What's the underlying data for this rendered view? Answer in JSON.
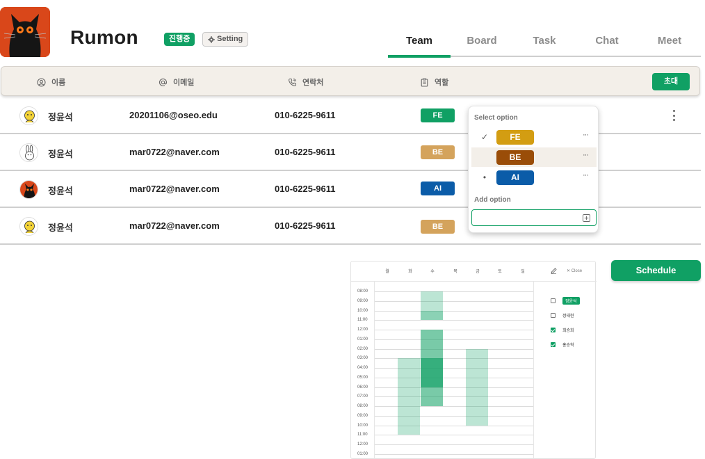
{
  "project": {
    "title": "Rumon",
    "status_badge": "진행중",
    "setting_label": "Setting"
  },
  "tabs": [
    {
      "label": "Team",
      "active": true
    },
    {
      "label": "Board",
      "active": false
    },
    {
      "label": "Task",
      "active": false
    },
    {
      "label": "Chat",
      "active": false
    },
    {
      "label": "Meet",
      "active": false
    }
  ],
  "table": {
    "columns": [
      {
        "label": "이름",
        "icon": "user-circle-icon"
      },
      {
        "label": "이메일",
        "icon": "at-icon"
      },
      {
        "label": "연락처",
        "icon": "phone-icon"
      },
      {
        "label": "역할",
        "icon": "clipboard-icon"
      }
    ],
    "invite_label": "초대",
    "rows": [
      {
        "name": "정윤석",
        "email": "20201106@oseo.edu",
        "phone": "010-6225-9611",
        "role": "FE",
        "avatar": "yellow-cartoon"
      },
      {
        "name": "정윤석",
        "email": "mar0722@naver.com",
        "phone": "010-6225-9611",
        "role": "BE",
        "avatar": "rabbit-sketch"
      },
      {
        "name": "정윤석",
        "email": "mar0722@naver.com",
        "phone": "010-6225-9611",
        "role": "AI",
        "avatar": "black-cat"
      },
      {
        "name": "정윤석",
        "email": "mar0722@naver.com",
        "phone": "010-6225-9611",
        "role": "BE",
        "avatar": "yellow-cartoon"
      }
    ]
  },
  "role_colors": {
    "FE": "#10a064",
    "BE": "#d4a35c",
    "AI": "#0b5ca8"
  },
  "dropdown": {
    "title": "Select option",
    "options": [
      {
        "label": "FE",
        "marker": "✓",
        "color": "#d39d12"
      },
      {
        "label": "BE",
        "marker": "",
        "color": "#9a4d08"
      },
      {
        "label": "AI",
        "marker": "•",
        "color": "#0b5ca8"
      }
    ],
    "more_label": "···",
    "add_label": "Add option",
    "input_value": ""
  },
  "schedule": {
    "button_label": "Schedule",
    "close_label": "Close",
    "days": [
      "월",
      "화",
      "수",
      "목",
      "금",
      "토",
      "일"
    ],
    "times": [
      "08:00",
      "09:00",
      "10:00",
      "11:00",
      "12:00",
      "01:00",
      "02:00",
      "03:00",
      "04:00",
      "05:00",
      "06:00",
      "07:00",
      "08:00",
      "09:00",
      "10:00",
      "11:00",
      "12:00",
      "01:00"
    ],
    "availability_slots": [
      {
        "day": "화",
        "start": "03:00",
        "end": "11:00",
        "overlap": 1
      },
      {
        "day": "수",
        "start": "10:00",
        "end": "11:00",
        "overlap": 1
      },
      {
        "day": "수",
        "start": "12:00",
        "end": "03:00",
        "overlap": 2
      },
      {
        "day": "수",
        "start": "03:00",
        "end": "06:00",
        "overlap": 3
      },
      {
        "day": "수",
        "start": "06:00",
        "end": "08:00",
        "overlap": 2
      },
      {
        "day": "수",
        "start": "08:00",
        "end": "11:00",
        "overlap": 1
      },
      {
        "day": "금",
        "start": "02:00",
        "end": "10:00",
        "overlap": 1
      }
    ],
    "members": [
      {
        "name": "정윤석",
        "checked": false,
        "highlight": true
      },
      {
        "name": "정태현",
        "checked": false,
        "highlight": false
      },
      {
        "name": "최승희",
        "checked": true,
        "highlight": false
      },
      {
        "name": "홍승혁",
        "checked": true,
        "highlight": false
      }
    ]
  }
}
